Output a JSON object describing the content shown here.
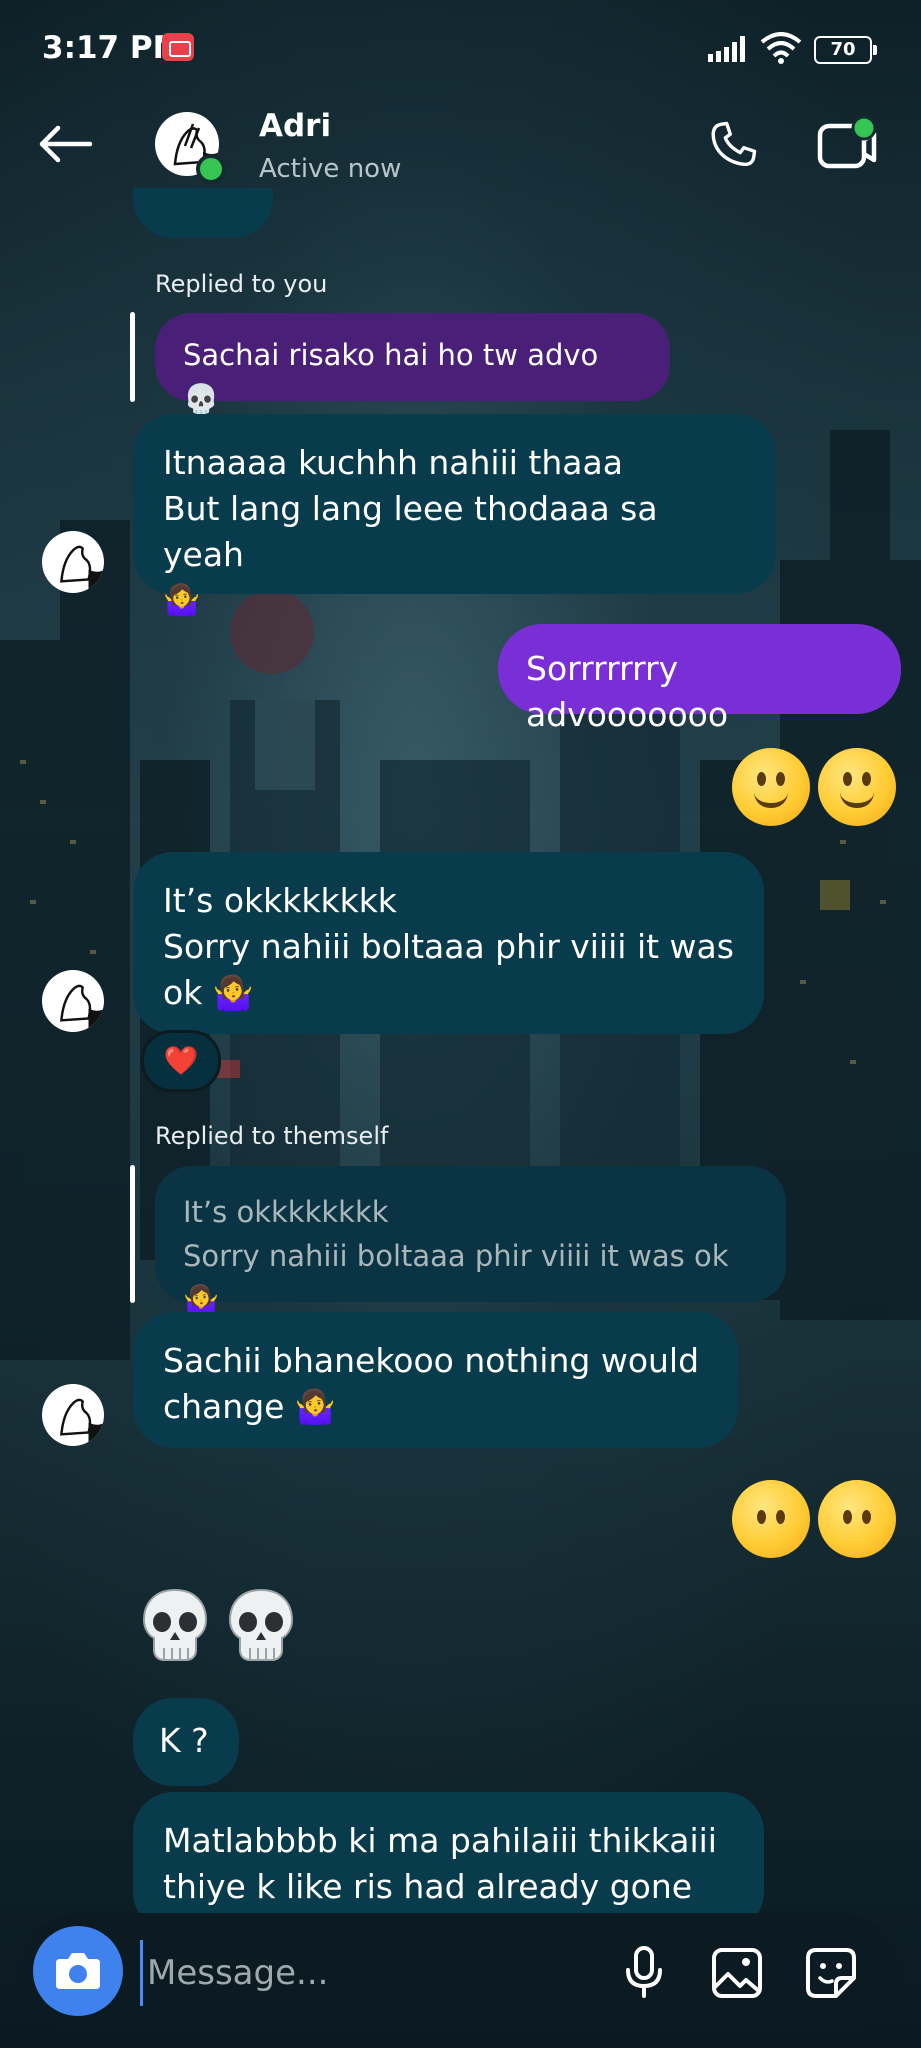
{
  "status_bar": {
    "time": "3:17 PM",
    "battery": "70"
  },
  "header": {
    "name": "Adri",
    "status": "Active now"
  },
  "messages": {
    "reply1_caption": "Replied to you",
    "reply1_quote": "Sachai risako hai ho tw advo 💀",
    "msg1_line1": "Itnaaaa kuchhh nahiii thaaa",
    "msg1_line2": "But lang lang leee thodaaa sa yeah",
    "msg1_emoji": "🤷‍♀️",
    "out1": "Sorrrrrrry advooooooo",
    "msg2_line1": "It’s okkkkkkkk",
    "msg2_line2": "Sorry nahiii boltaaa phir viiii it was",
    "msg2_line3": "ok 🤷‍♀️",
    "reaction": "❤️",
    "reply2_caption": "Replied to themself",
    "reply2_quote_line1": "It’s okkkkkkkk",
    "reply2_quote_line2": "Sorry nahiii boltaaa phir viiii it was ok 🤷‍♀️",
    "msg3_line1": "Sachii bhanekooo nothing would",
    "msg3_line2": "change 🤷‍♀️",
    "msg4": "K ?",
    "msg5_line1": "Matlabbbb ki ma pahilaiii thikkaiii",
    "msg5_line2": "thiye k like ris had already gone"
  },
  "composer": {
    "placeholder": "Message..."
  },
  "icons": {
    "back": "back-arrow-icon",
    "call": "phone-icon",
    "video": "video-call-icon",
    "camera": "camera-icon",
    "mic": "microphone-icon",
    "gallery": "gallery-icon",
    "sticker": "sticker-icon"
  },
  "colors": {
    "incoming_bubble": "#083c4c",
    "outgoing_bubble": "#7a2fd6",
    "quote_bubble": "#4a1f78",
    "camera_button": "#3f82ee",
    "online": "#36c552"
  }
}
